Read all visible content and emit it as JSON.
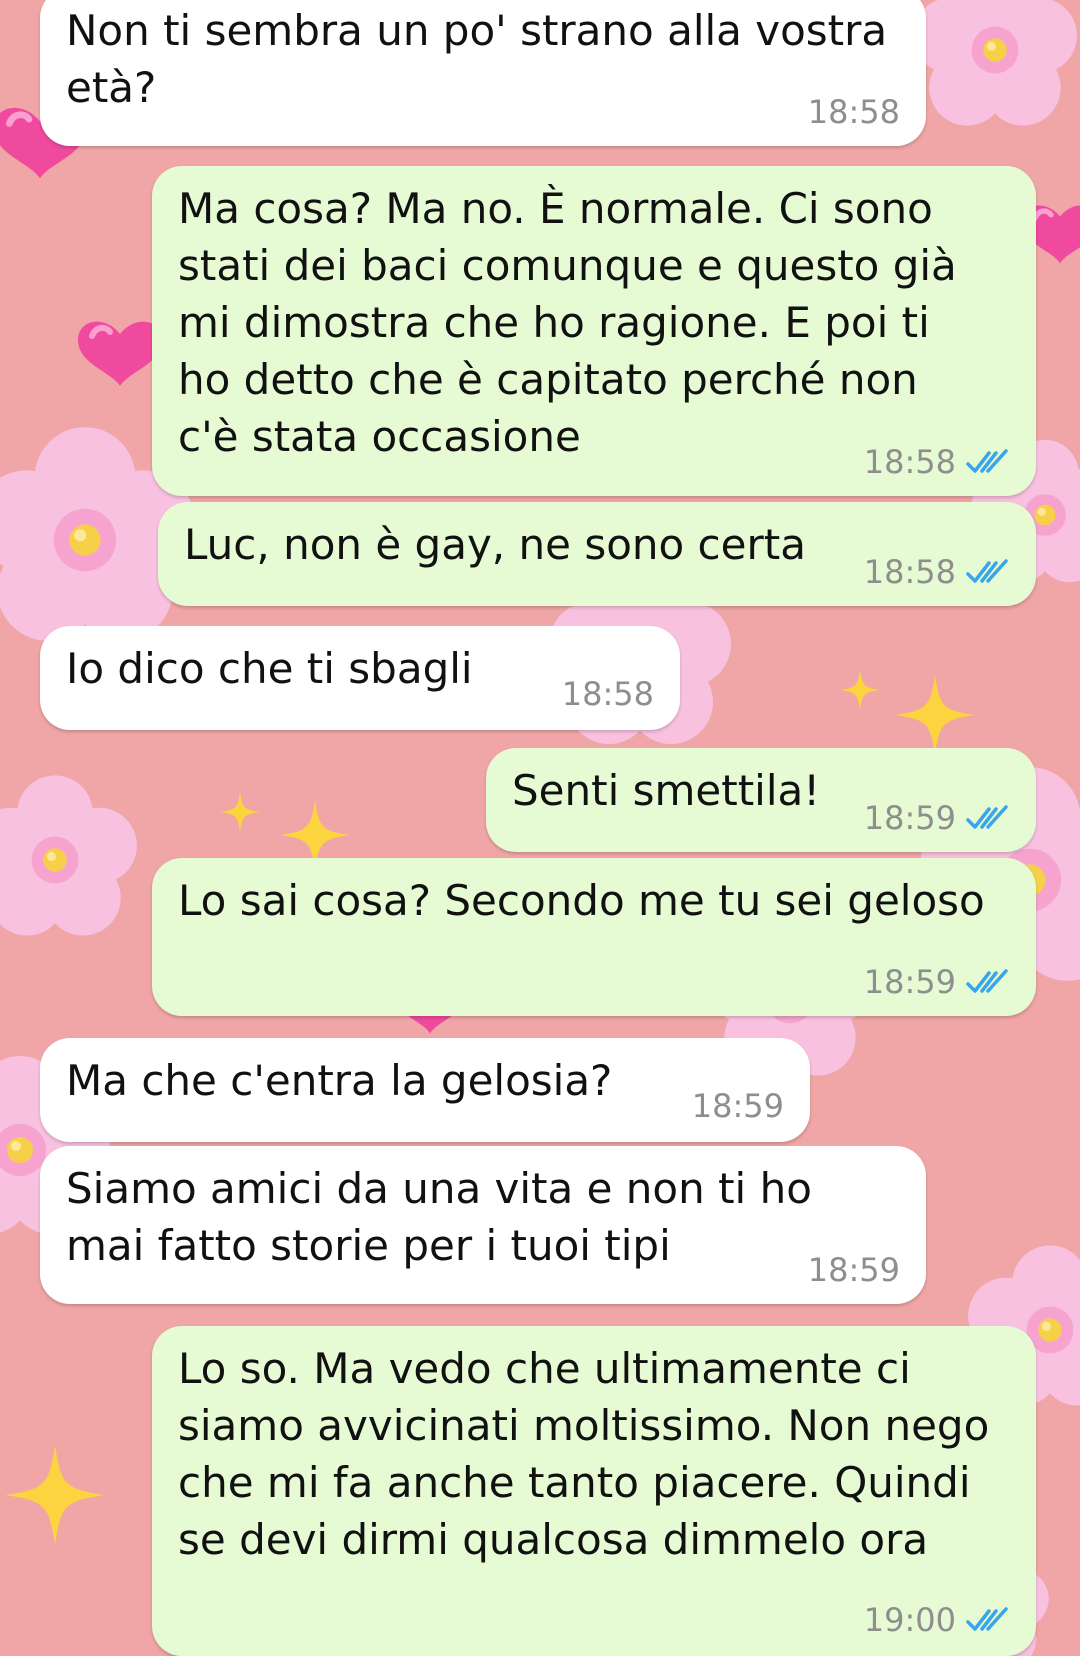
{
  "colors": {
    "wallpaper": "#f0a5a6",
    "incoming_bubble": "#ffffff",
    "outgoing_bubble": "#e6fbd4",
    "timestamp": "#8e8e8e",
    "read_ticks": "#3aa5e8"
  },
  "wallpaper": {
    "decorations": [
      "cherry-blossom-icon",
      "pink-heart-icon",
      "sparkle-star-icon"
    ]
  },
  "messages": [
    {
      "direction": "incoming",
      "text": "Non ti sembra un po' strano alla vostra\netà?",
      "time": "18:58"
    },
    {
      "direction": "outgoing",
      "text": "Ma cosa? Ma no. È normale. Ci sono\nstati dei baci comunque e questo già\nmi dimostra che ho ragione. E poi ti\nho detto che è capitato perché non\nc'è stata occasione",
      "time": "18:58",
      "status": "read",
      "status_icon": "double-check-icon"
    },
    {
      "direction": "outgoing",
      "text": "Luc, non è gay, ne sono certa",
      "time": "18:58",
      "status": "read",
      "status_icon": "double-check-icon"
    },
    {
      "direction": "incoming",
      "text": "Io dico che ti sbagli",
      "time": "18:58"
    },
    {
      "direction": "outgoing",
      "text": "Senti smettila!",
      "time": "18:59",
      "status": "read",
      "status_icon": "double-check-icon"
    },
    {
      "direction": "outgoing",
      "text": "Lo sai cosa? Secondo me tu sei geloso",
      "time": "18:59",
      "status": "read",
      "status_icon": "double-check-icon"
    },
    {
      "direction": "incoming",
      "text": "Ma che c'entra la gelosia?",
      "time": "18:59"
    },
    {
      "direction": "incoming",
      "text": "Siamo amici da una vita e non ti ho\nmai fatto storie per i tuoi tipi",
      "time": "18:59"
    },
    {
      "direction": "outgoing",
      "text": "Lo so. Ma vedo che ultimamente ci\nsiamo avvicinati moltissimo. Non nego\nche mi fa anche tanto piacere. Quindi\nse devi dirmi qualcosa dimmelo ora",
      "time": "19:00",
      "status": "read",
      "status_icon": "double-check-icon"
    }
  ]
}
